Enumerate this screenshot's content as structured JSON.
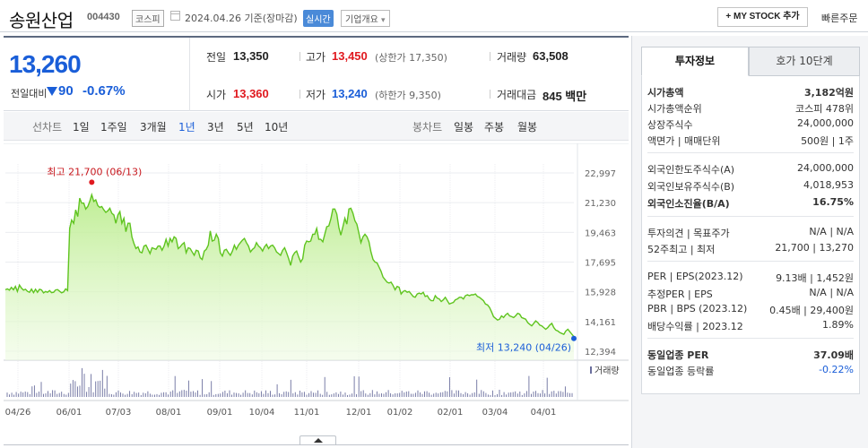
{
  "header": {
    "title": "송원산업",
    "code": "004430",
    "market": "코스피",
    "date": "2024.04.26 기준(장마감)",
    "realtime": "실시간",
    "overview": "기업개요",
    "overview_caret": "▾",
    "mystock": "+ MY STOCK 추가",
    "quick_order": "빠른주문"
  },
  "price": {
    "current": "13,260",
    "change_label": "전일대비",
    "change": "90",
    "change_pct": "-0.67%",
    "prev_label": "전일",
    "prev": "13,350",
    "open_label": "시가",
    "open": "13,360",
    "high_label": "고가",
    "high": "13,450",
    "upper_limit": "(상한가 17,350)",
    "low_label": "저가",
    "low": "13,240",
    "lower_limit": "(하한가 9,350)",
    "volume_label": "거래량",
    "volume": "63,508",
    "amount_label": "거래대금",
    "amount": "845 백만"
  },
  "periods": {
    "line_label": "선차트",
    "line_items": [
      "1일",
      "1주일",
      "3개월",
      "1년",
      "3년",
      "5년",
      "10년"
    ],
    "active": "1년",
    "candle_label": "봉차트",
    "candle_items": [
      "일봉",
      "주봉",
      "월봉"
    ]
  },
  "chart_data": {
    "type": "area",
    "y_ticks": [
      "22,997",
      "21,230",
      "19,463",
      "17,695",
      "15,928",
      "14,161",
      "12,394"
    ],
    "ylim": [
      12394,
      22997
    ],
    "x_ticks": [
      "04/26",
      "06/01",
      "07/03",
      "08/01",
      "09/01",
      "10/04",
      "11/01",
      "12/01",
      "01/02",
      "02/01",
      "03/04",
      "04/01"
    ],
    "high_annotation": "최고 21,700 (06/13)",
    "low_annotation": "최저 13,240 (04/26)",
    "volume_label": "거래량",
    "series": [
      {
        "values": [
          16050,
          16100,
          16030,
          16190,
          16050,
          16250,
          15950,
          16330,
          16150,
          16030,
          16080,
          15960,
          15900,
          16090,
          15880,
          16080,
          15900,
          16080,
          16040,
          15860,
          15950,
          15900,
          16000,
          15880,
          15900,
          16040,
          16060,
          15960,
          15870,
          15920,
          16100,
          16000,
          19700,
          20200,
          20000,
          20800,
          20400,
          21500,
          21200,
          21200,
          20850,
          21000,
          21300,
          21700,
          21300,
          21400,
          21050,
          20950,
          21000,
          20800,
          20650,
          20750,
          20900,
          20600,
          20500,
          20000,
          20500,
          20700,
          20000,
          20300,
          19500,
          20000,
          20000,
          19200,
          18800,
          18500,
          18600,
          18300,
          18250,
          18650,
          18700,
          18450,
          18200,
          18550,
          18500,
          18450,
          18650,
          18650,
          18400,
          18650,
          19050,
          18650,
          19100,
          18900,
          19200,
          19100,
          18500,
          18600,
          18750,
          18850,
          18250,
          18550,
          18500,
          18300,
          18100,
          18400,
          18350,
          17950,
          17850,
          18350,
          18450,
          18700,
          19550,
          18950,
          19000,
          19350,
          19100,
          18250,
          18050,
          18400,
          18450,
          18250,
          18100,
          18350,
          18700,
          18450,
          18700,
          18850,
          19000,
          19100,
          18850,
          18650,
          18300,
          18450,
          18550,
          18850,
          18650,
          18550,
          18350,
          18600,
          18750,
          18500,
          18650,
          18700,
          18550,
          18300,
          18200,
          18100,
          18400,
          18550,
          18250,
          17900,
          17500,
          18050,
          18250,
          18350,
          18000,
          17700,
          17900,
          18700,
          18950,
          18900,
          18950,
          19350,
          19350,
          19700,
          19050,
          19050,
          18900,
          19350,
          19800,
          19850,
          20250,
          20850,
          20850,
          20550,
          19750,
          19300,
          19800,
          20300,
          19950,
          20850,
          20900,
          20600,
          20150,
          19950,
          19400,
          18850,
          19200,
          19350,
          19200,
          18900,
          18300,
          17850,
          17700,
          17650,
          17400,
          17150,
          16800,
          16650,
          16500,
          16450,
          16500,
          16300,
          16050,
          16250,
          16200,
          15800,
          15950,
          16000,
          15900,
          15950,
          15800,
          15650,
          15600,
          15800,
          15850,
          15800,
          15900,
          15650,
          15700,
          15500,
          15400,
          15400,
          15700,
          15550,
          15500,
          15350,
          15450,
          15600,
          15400,
          15200,
          15250,
          15300,
          15450,
          15500,
          15600,
          15600,
          15500,
          15700,
          15750,
          15700,
          15750,
          15750,
          15800,
          15650,
          15600,
          15500,
          15400,
          15200,
          15150,
          15000,
          14750,
          14450,
          14350,
          14250,
          14300,
          14500,
          14400,
          14550,
          14650,
          14500,
          14450,
          14400,
          14500,
          14650,
          14600,
          14400,
          14350,
          14300,
          14100,
          14000,
          13900,
          14050,
          14200,
          14100,
          13950,
          13900,
          13800,
          13700,
          13800,
          13950,
          14050,
          13800,
          13650,
          13600,
          13500,
          13450,
          13400,
          13600,
          13700,
          13550,
          13400,
          13260
        ]
      }
    ]
  },
  "side": {
    "tab_active": "투자정보",
    "tab_other": "호가 10단계",
    "rows1": [
      {
        "label": "시가총액",
        "value": "3,182억원",
        "bold": true
      },
      {
        "label": "시가총액순위",
        "value": "코스피 478위"
      },
      {
        "label": "상장주식수",
        "value": "24,000,000"
      },
      {
        "label": "액면가 | 매매단위",
        "value": "500원 | 1주"
      }
    ],
    "rows2": [
      {
        "label": "외국인한도주식수(A)",
        "value": "24,000,000"
      },
      {
        "label": "외국인보유주식수(B)",
        "value": "4,018,953"
      },
      {
        "label": "외국인소진율(B/A)",
        "value": "16.75%",
        "bold": true
      }
    ],
    "rows3": [
      {
        "label": "투자의견 | 목표주가",
        "value": "N/A | N/A"
      },
      {
        "label": "52주최고 | 최저",
        "value": "21,700 | 13,270"
      }
    ],
    "rows4": [
      {
        "label": "PER | EPS(2023.12)",
        "value": "9.13배 | 1,452원"
      },
      {
        "label": "추정PER | EPS",
        "value": "N/A | N/A"
      },
      {
        "label": "PBR | BPS (2023.12)",
        "value": "0.45배 | 29,400원"
      },
      {
        "label": "배당수익률 | 2023.12",
        "value": "1.89%"
      }
    ],
    "rows5": [
      {
        "label": "동일업종 PER",
        "value": "37.09배",
        "bold": true
      },
      {
        "label": "동일업종 등락률",
        "value": "-0.22%"
      }
    ]
  }
}
